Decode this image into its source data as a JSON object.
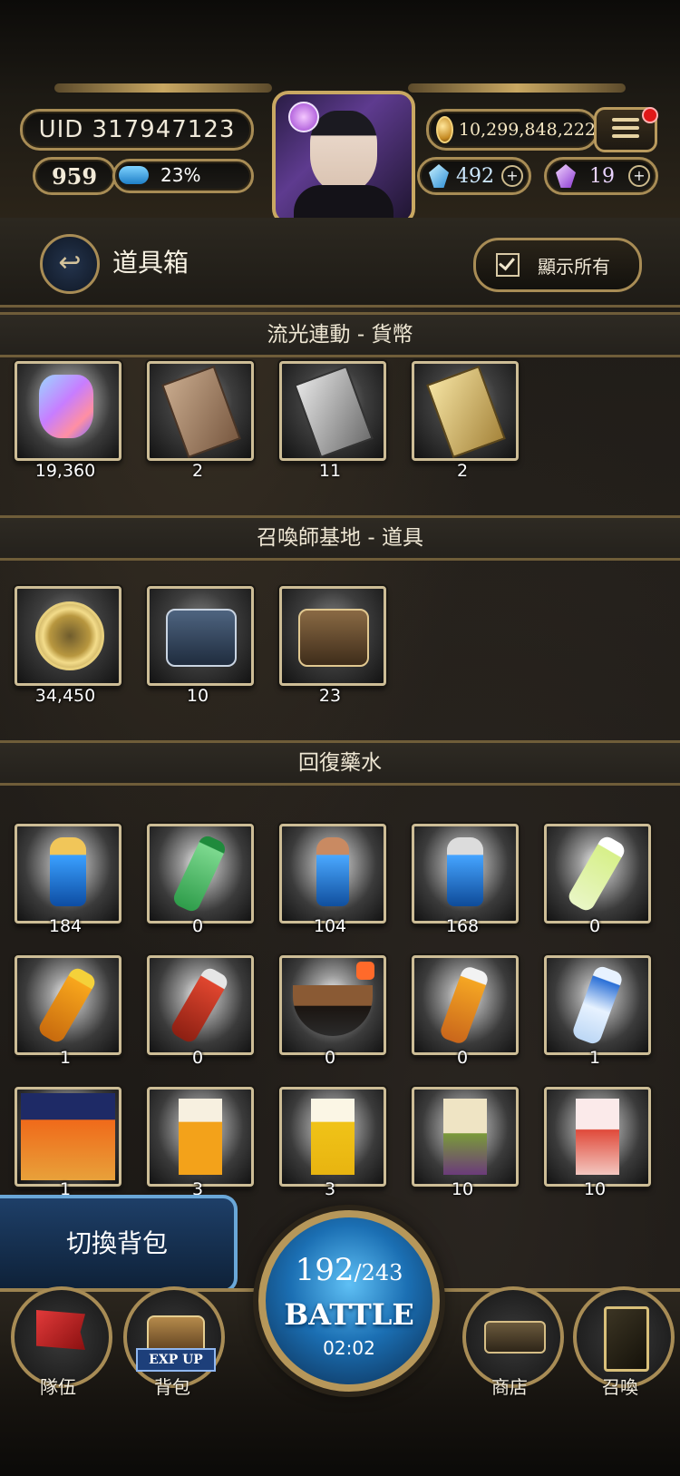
{
  "header": {
    "uid": "UID 317947123",
    "level": "959",
    "exp_percent": "23%",
    "exp_fraction": 0.23,
    "gold": "10,299,848,222",
    "blue_gems": "492",
    "purple_gems": "19"
  },
  "page": {
    "title": "道具箱",
    "show_all_label": "顯示所有"
  },
  "sections": [
    {
      "title": "流光連動 - 貨幣",
      "items": [
        {
          "icon": "prism-crystal-icon",
          "count": "19,360"
        },
        {
          "icon": "bronze-card-icon",
          "count": "2"
        },
        {
          "icon": "silver-card-icon",
          "count": "11"
        },
        {
          "icon": "gold-card-icon",
          "count": "2"
        }
      ]
    },
    {
      "title": "召喚師基地 - 道具",
      "items": [
        {
          "icon": "gold-medal-icon",
          "count": "34,450"
        },
        {
          "icon": "blue-toolbox-icon",
          "count": "10"
        },
        {
          "icon": "brown-toolbox-icon",
          "count": "23"
        }
      ]
    },
    {
      "title": "回復藥水",
      "items": [
        {
          "icon": "gold-potion-icon",
          "count": "184"
        },
        {
          "icon": "soda-bottle-icon",
          "count": "0"
        },
        {
          "icon": "bronze-potion-icon",
          "count": "104"
        },
        {
          "icon": "silver-potion-icon",
          "count": "168"
        },
        {
          "icon": "water-bottle-icon",
          "count": "0"
        },
        {
          "icon": "lemon-tea-icon",
          "count": "1"
        },
        {
          "icon": "red-tea-icon",
          "count": "0"
        },
        {
          "icon": "beef-noodle-icon",
          "count": "0"
        },
        {
          "icon": "green-tea-icon",
          "count": "0"
        },
        {
          "icon": "deep-water-icon",
          "count": "1"
        },
        {
          "icon": "chips-bag-icon",
          "count": "1"
        },
        {
          "icon": "milk-tea-carton-icon",
          "count": "3"
        },
        {
          "icon": "tangle-tea-carton-icon",
          "count": "3"
        },
        {
          "icon": "fruit-tea-carton-icon",
          "count": "10"
        },
        {
          "icon": "apple-tea-carton-icon",
          "count": "10"
        }
      ]
    }
  ],
  "bottom": {
    "switch_bag": "切換背包",
    "battle": {
      "stamina": "192",
      "stamina_max": "/243",
      "label": "BATTLE",
      "timer": "02:02"
    },
    "nav": [
      {
        "label": "隊伍",
        "icon": "team-flag-icon"
      },
      {
        "label": "背包",
        "icon": "backpack-chest-icon",
        "badge": "EXP UP"
      },
      {
        "label": "商店",
        "icon": "shop-sign-icon"
      },
      {
        "label": "召喚",
        "icon": "summon-card-icon"
      }
    ]
  },
  "colors": {
    "accent_gold": "#c9a862",
    "exp_blue": "#1f7fc7",
    "battle_blue": "#1b6fb3"
  }
}
